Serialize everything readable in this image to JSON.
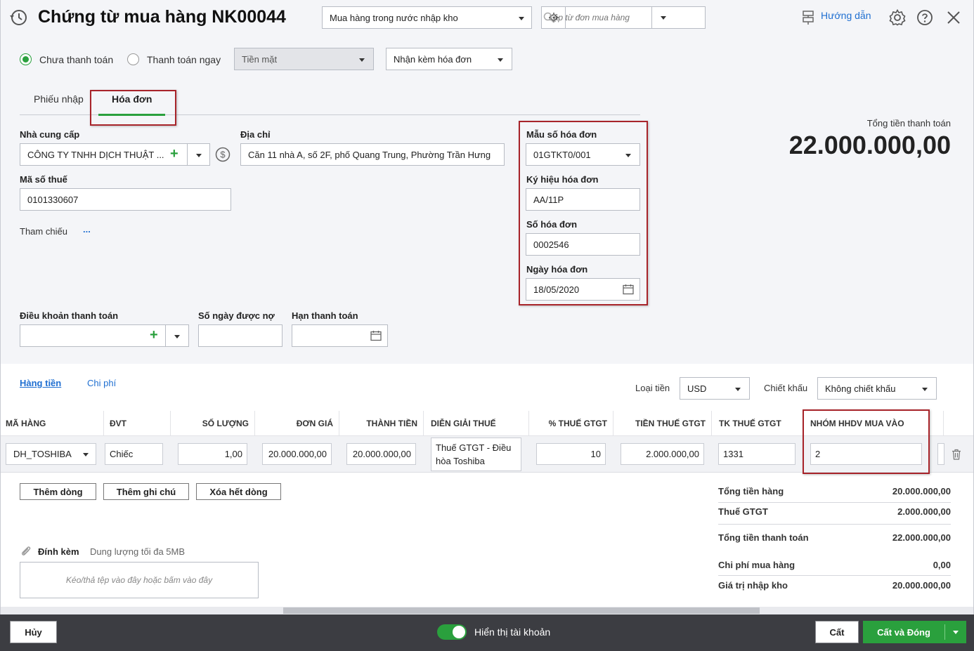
{
  "header": {
    "title": "Chứng từ mua hàng NK00044",
    "type_select": "Mua hàng trong nước nhập kho",
    "order_search_placeholder": "Lập từ đơn mua hàng",
    "guide_label": "Hướng dẫn"
  },
  "payment": {
    "unpaid_label": "Chưa thanh toán",
    "paid_label": "Thanh toán ngay",
    "method": "Tiền mặt",
    "invoice_option": "Nhận kèm hóa đơn",
    "unpaid_selected": true
  },
  "tabs": [
    {
      "label": "Phiếu nhập",
      "active": false
    },
    {
      "label": "Hóa đơn",
      "active": true
    }
  ],
  "supplier": {
    "label": "Nhà cung cấp",
    "value": "CÔNG TY TNHH DỊCH THUẬT ...",
    "address_label": "Địa chỉ",
    "address": "Căn 11 nhà A, số 2F, phố Quang Trung, Phường Trần Hưng",
    "tax_label": "Mã số thuế",
    "tax_code": "0101330607",
    "reference_label": "Tham chiếu",
    "reference_more": "..."
  },
  "invoice": {
    "template_label": "Mẫu số hóa đơn",
    "template": "01GTKT0/001",
    "symbol_label": "Ký hiệu hóa đơn",
    "symbol": "AA/11P",
    "number_label": "Số hóa đơn",
    "number": "0002546",
    "date_label": "Ngày hóa đơn",
    "date": "18/05/2020"
  },
  "total_box": {
    "label": "Tổng tiền thanh toán",
    "amount": "22.000.000,00"
  },
  "terms": {
    "terms_label": "Điều khoản thanh toán",
    "days_label": "Số ngày được nợ",
    "due_label": "Hạn thanh toán"
  },
  "detail_tabs": {
    "goods": "Hàng tiền",
    "costs": "Chi phí",
    "currency_label": "Loại tiền",
    "currency": "USD",
    "discount_label": "Chiết khấu",
    "discount": "Không chiết khấu"
  },
  "table": {
    "columns": [
      "MÃ HÀNG",
      "ĐVT",
      "SỐ LƯỢNG",
      "ĐƠN GIÁ",
      "THÀNH TIỀN",
      "DIỄN GIẢI THUẾ",
      "% THUẾ GTGT",
      "TIỀN THUẾ GTGT",
      "TK THUẾ GTGT",
      "NHÓM HHDV MUA VÀO"
    ],
    "row": {
      "item_code": "DH_TOSHIBA",
      "unit": "Chiếc",
      "quantity": "1,00",
      "unit_price": "20.000.000,00",
      "amount": "20.000.000,00",
      "tax_desc": "Thuế GTGT - Điều hòa Toshiba",
      "vat_rate": "10",
      "vat_amount": "2.000.000,00",
      "vat_account": "1331",
      "goods_group": "2"
    }
  },
  "actions": {
    "add_row": "Thêm dòng",
    "add_note": "Thêm ghi chú",
    "delete_rows": "Xóa hết dòng"
  },
  "attachment": {
    "label": "Đính kèm",
    "limit": "Dung lượng tối đa 5MB",
    "drop_hint": "Kéo/thả tệp vào đây hoặc bấm vào đây"
  },
  "summary": [
    {
      "label": "Tổng tiền hàng",
      "value": "20.000.000,00"
    },
    {
      "label": "Thuế GTGT",
      "value": "2.000.000,00"
    },
    {
      "label": "Tổng tiền thanh toán",
      "value": "22.000.000,00"
    },
    {
      "label": "Chi phí mua hàng",
      "value": "0,00"
    },
    {
      "label": "Giá trị nhập kho",
      "value": "20.000.000,00"
    }
  ],
  "footer": {
    "cancel": "Hủy",
    "toggle_label": "Hiển thị tài khoản",
    "toggle_on": true,
    "save": "Cất",
    "save_close": "Cất và Đóng"
  },
  "colors": {
    "accent_green": "#2aa03d",
    "link_blue": "#1f6fd1",
    "highlight_red": "#a8242a",
    "footer_bg": "#3c3d42"
  }
}
